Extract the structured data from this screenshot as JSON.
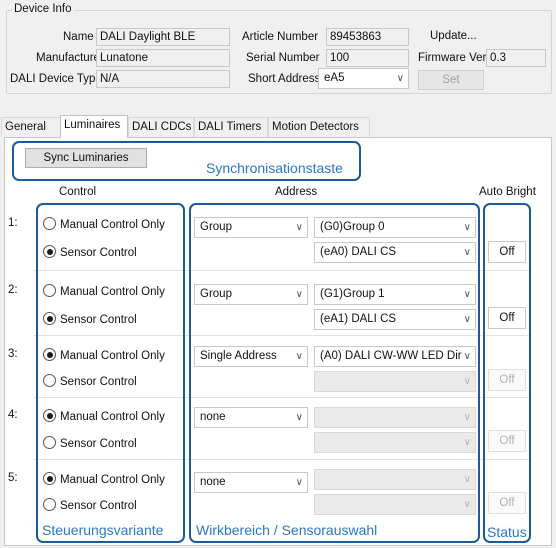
{
  "device_info": {
    "title": "Device Info",
    "name_label": "Name",
    "name_value": "DALI Daylight BLE",
    "manufacturer_label": "Manufacturer",
    "manufacturer_value": "Lunatone",
    "dali_device_type_label": "DALI Device Type",
    "dali_device_type_value": "N/A",
    "article_number_label": "Article Number",
    "article_number_value": "89453863",
    "serial_number_label": "Serial Number",
    "serial_number_value": "100",
    "short_address_label": "Short Address",
    "short_address_value": "eA5",
    "update_label": "Update...",
    "firmware_label": "Firmware Ver",
    "firmware_value": "0.3",
    "set_label": "Set"
  },
  "tabs": [
    "General",
    "Luminaires",
    "DALI CDCs",
    "DALI Timers",
    "Motion Detectors"
  ],
  "active_tab": "Luminaires",
  "luminaires": {
    "sync_button": "Sync Luminaries",
    "headers": {
      "control": "Control",
      "address": "Address",
      "auto_bright": "Auto Bright"
    },
    "radio_manual": "Manual Control Only",
    "radio_sensor": "Sensor Control",
    "rows": [
      {
        "num": "1:",
        "control": "sensor",
        "address_type": "Group",
        "group": "(G0)Group 0",
        "sensor": "(eA0) DALI CS",
        "auto_bright": "Off",
        "auto_enabled": true
      },
      {
        "num": "2:",
        "control": "sensor",
        "address_type": "Group",
        "group": "(G1)Group 1",
        "sensor": "(eA1) DALI CS",
        "auto_bright": "Off",
        "auto_enabled": true
      },
      {
        "num": "3:",
        "control": "manual",
        "address_type": "Single Address",
        "group": "(A0) DALI CW-WW LED Dir",
        "sensor": "",
        "auto_bright": "Off",
        "auto_enabled": false
      },
      {
        "num": "4:",
        "control": "manual",
        "address_type": "none",
        "group": "",
        "sensor": "",
        "auto_bright": "Off",
        "auto_enabled": false
      },
      {
        "num": "5:",
        "control": "manual",
        "address_type": "none",
        "group": "",
        "sensor": "",
        "auto_bright": "Off",
        "auto_enabled": false
      }
    ]
  },
  "annotations": {
    "sync": "Synchronisationstaste",
    "control": "Steuerungsvariante",
    "address": "Wirkbereich / Sensorauswahl",
    "status": "Status"
  },
  "colors": {
    "annotation_border": "#1b5b97",
    "annotation_text": "#2a78c5"
  }
}
